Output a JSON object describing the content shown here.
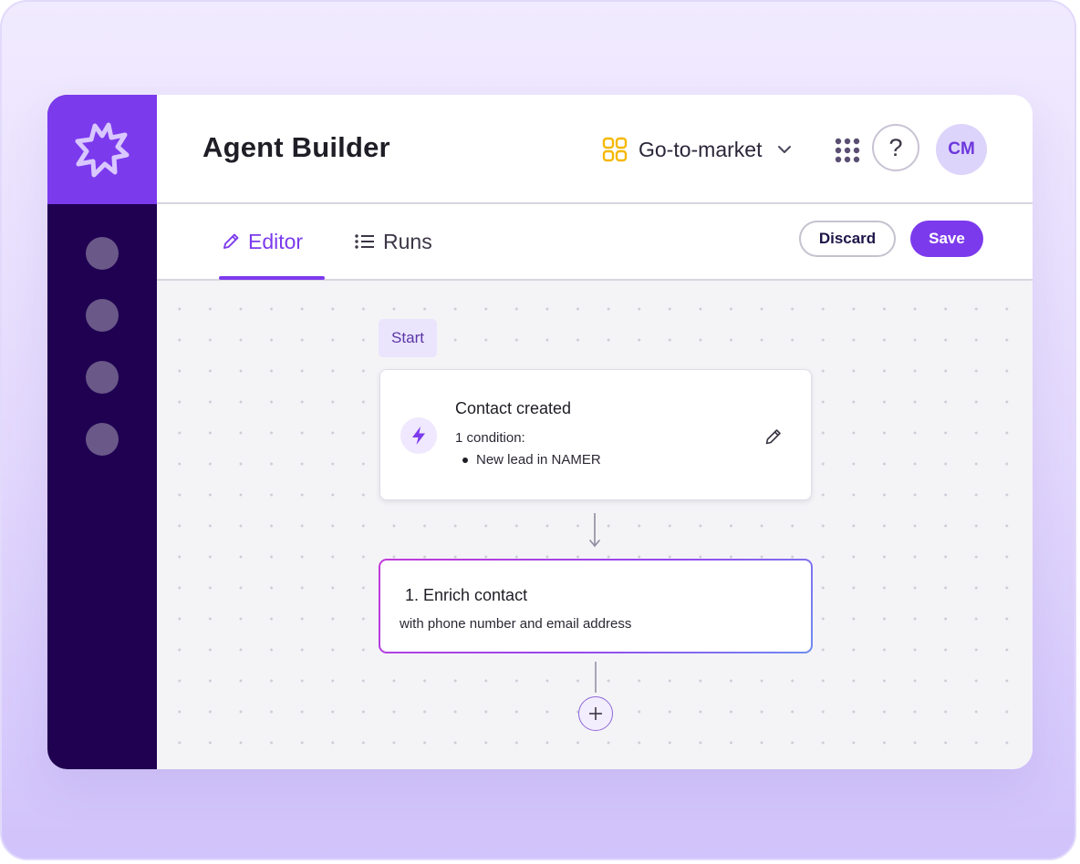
{
  "app": {
    "title": "Agent Builder"
  },
  "header": {
    "workspace_label": "Go-to-market",
    "help_label": "?",
    "avatar_initials": "CM"
  },
  "tabs": [
    {
      "label": "Editor",
      "icon": "pencil-icon",
      "active": true
    },
    {
      "label": "Runs",
      "icon": "list-icon",
      "active": false
    }
  ],
  "actions": {
    "discard_label": "Discard",
    "save_label": "Save"
  },
  "flow": {
    "start_label": "Start",
    "trigger": {
      "title": "Contact created",
      "condition_summary": "1 condition:",
      "conditions": [
        "New lead in NAMER"
      ],
      "icon": "lightning-bolt-icon"
    },
    "steps": [
      {
        "title": "1. Enrich contact",
        "subtitle": "with phone number and email address"
      }
    ]
  },
  "colors": {
    "accent": "#7c3aed",
    "sidebar": "#1f0051",
    "workspace_icon": "#f5b800"
  }
}
